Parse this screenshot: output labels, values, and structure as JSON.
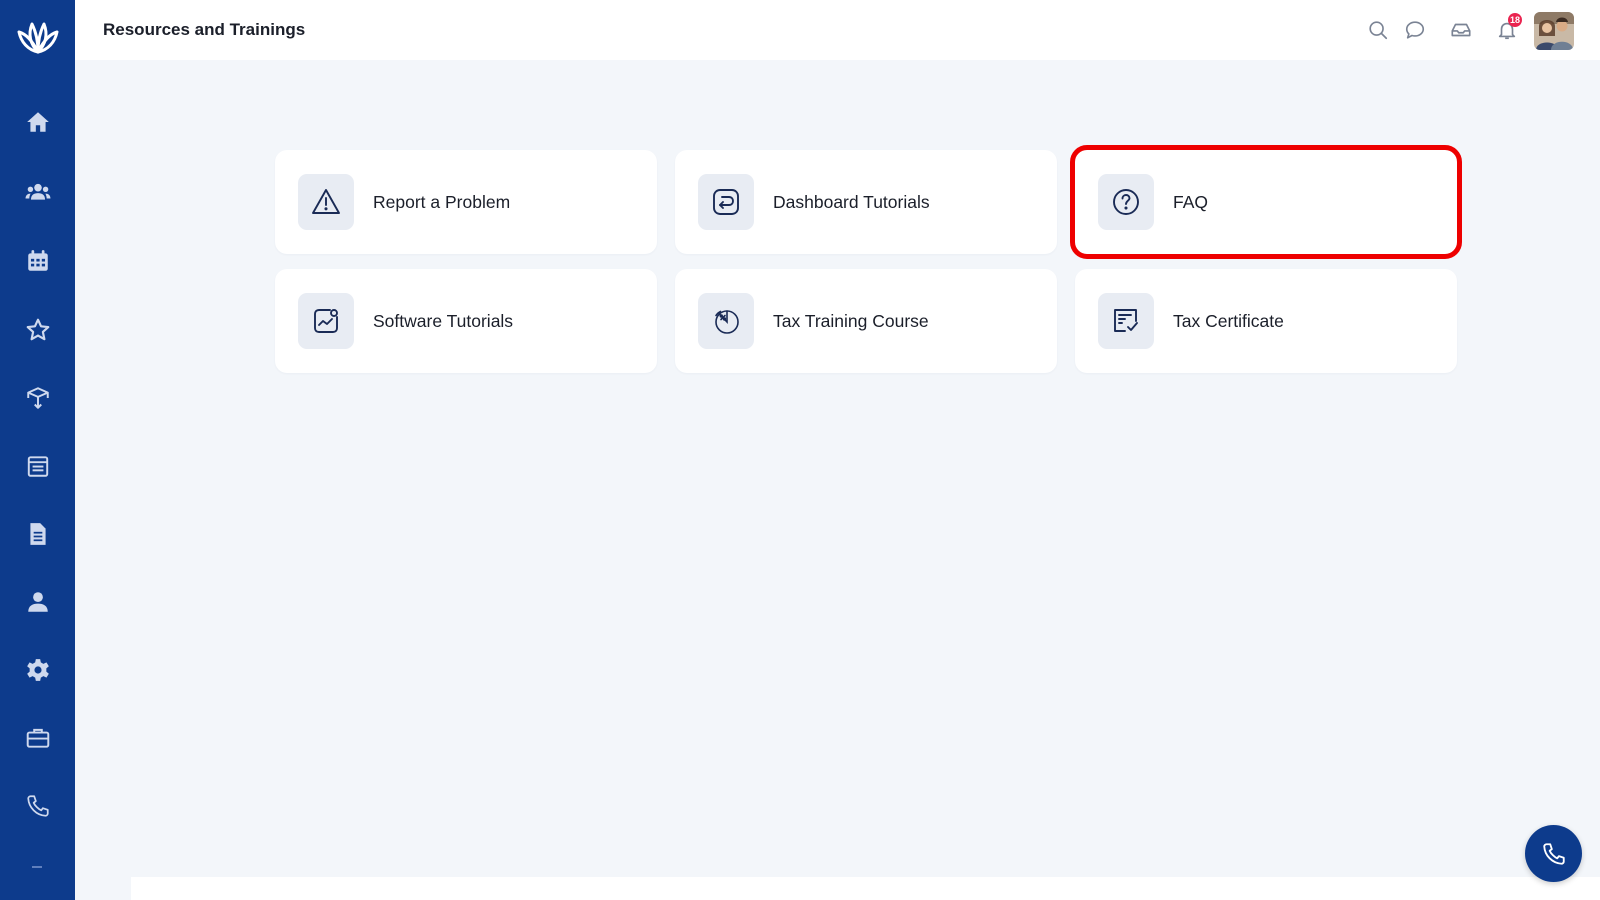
{
  "header": {
    "title": "Resources and Trainings",
    "notification_count": "18"
  },
  "sidebar": {
    "logo": "lotus-logo",
    "items": [
      {
        "icon": "home-icon"
      },
      {
        "icon": "users-icon"
      },
      {
        "icon": "calendar-icon"
      },
      {
        "icon": "star-icon"
      },
      {
        "icon": "box-upload-icon"
      },
      {
        "icon": "calendar-list-icon"
      },
      {
        "icon": "document-icon"
      },
      {
        "icon": "user-icon"
      },
      {
        "icon": "gear-icon"
      },
      {
        "icon": "briefcase-icon"
      },
      {
        "icon": "phone-icon"
      }
    ]
  },
  "cards": [
    {
      "label": "Report a Problem",
      "icon": "warning-icon"
    },
    {
      "label": "Dashboard Tutorials",
      "icon": "return-icon"
    },
    {
      "label": "FAQ",
      "icon": "question-icon",
      "highlighted": true
    },
    {
      "label": "Software Tutorials",
      "icon": "chart-image-icon"
    },
    {
      "label": "Tax Training Course",
      "icon": "percent-pie-icon"
    },
    {
      "label": "Tax Certificate",
      "icon": "certificate-icon"
    }
  ],
  "colors": {
    "sidebar": "#0d3b8c",
    "background": "#f3f6fa",
    "highlight": "#ee0000",
    "badge": "#ea2450",
    "icon_tile": "#e8ecf3"
  }
}
